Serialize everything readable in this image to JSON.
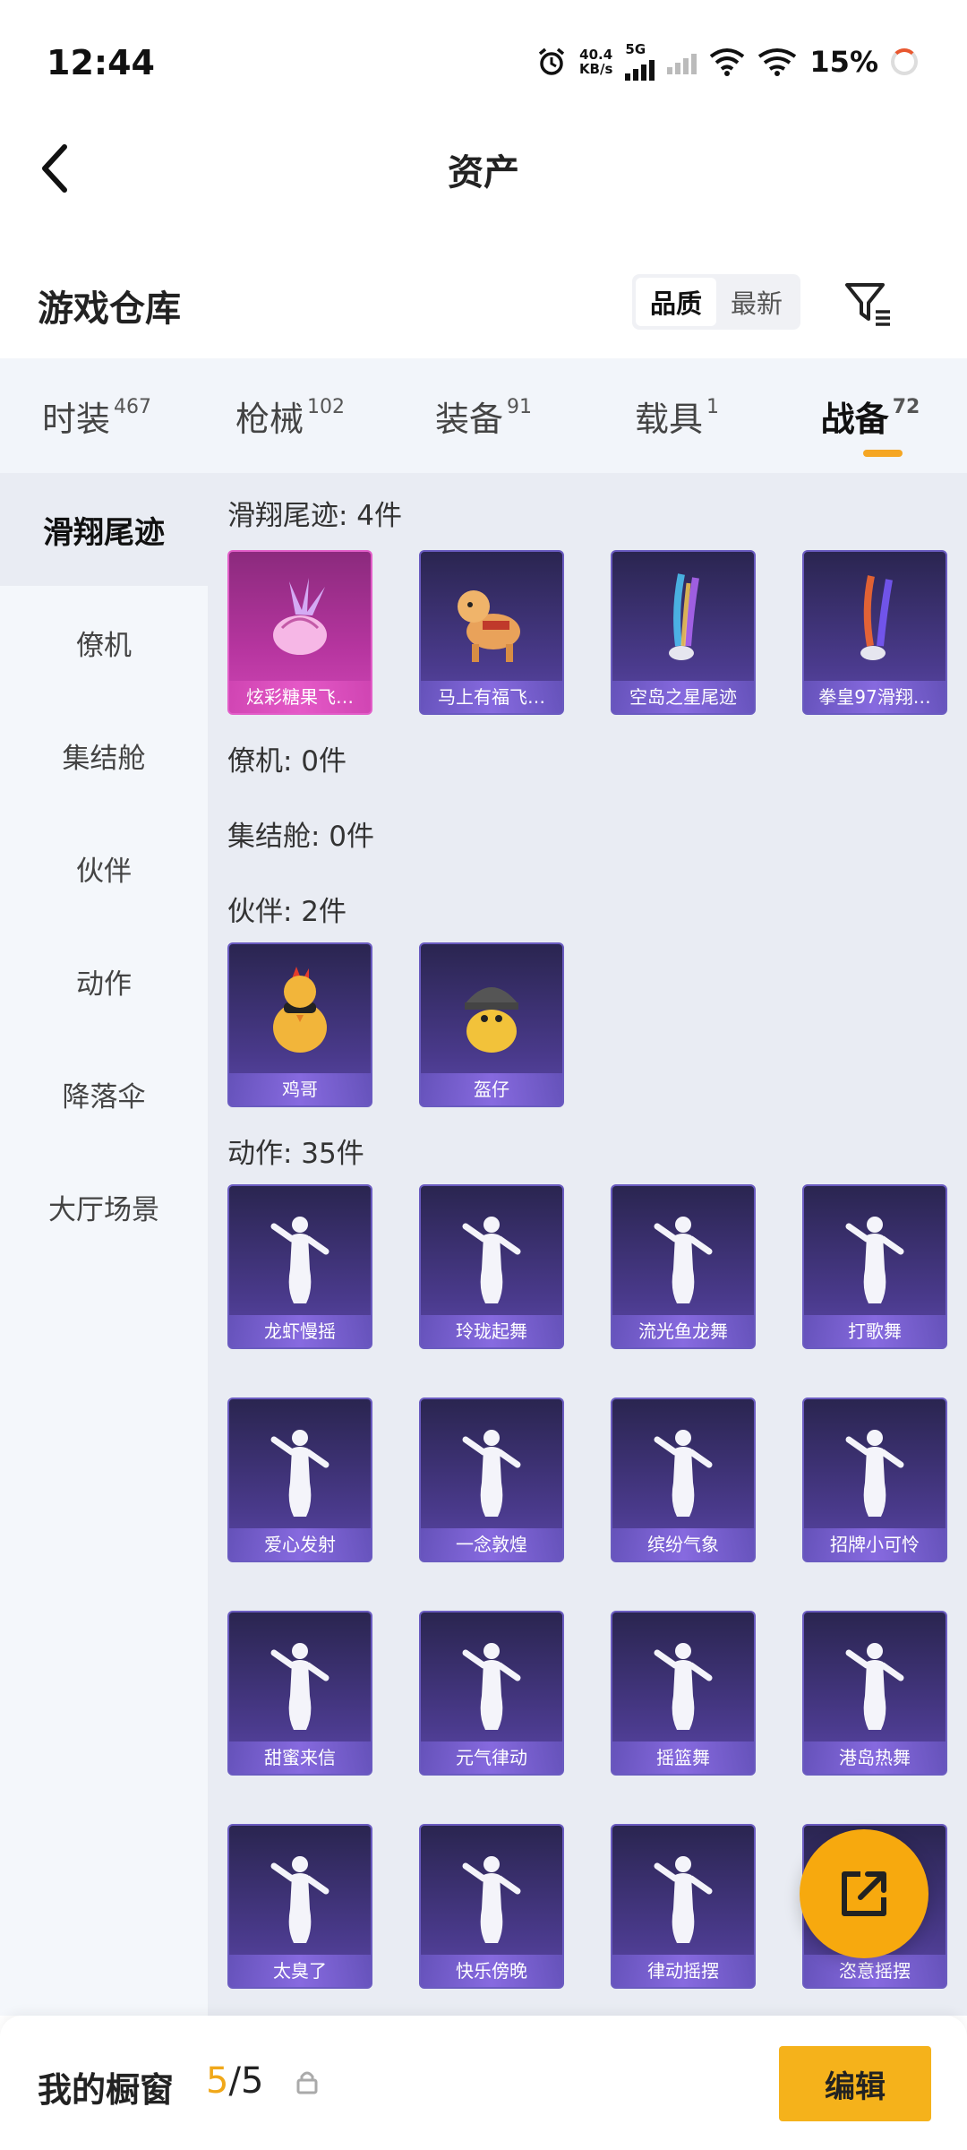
{
  "status_bar": {
    "time": "12:44",
    "net_speed_value": "40.4",
    "net_speed_unit": "KB/s",
    "network_type": "5G",
    "battery": "15%"
  },
  "header": {
    "title": "资产"
  },
  "warehouse": {
    "title": "游戏仓库",
    "sort_options": [
      "品质",
      "最新"
    ]
  },
  "tabs": [
    {
      "label": "时装",
      "count": "467"
    },
    {
      "label": "枪械",
      "count": "102"
    },
    {
      "label": "装备",
      "count": "91"
    },
    {
      "label": "载具",
      "count": "1"
    },
    {
      "label": "战备",
      "count": "72"
    }
  ],
  "sidebar": [
    "滑翔尾迹",
    "僚机",
    "集结舱",
    "伙伴",
    "动作",
    "降落伞",
    "大厅场景"
  ],
  "sections": {
    "glide": "滑翔尾迹: 4件",
    "wingman": "僚机: 0件",
    "assembly": "集结舱: 0件",
    "partner": "伙伴: 2件",
    "emote": "动作: 35件"
  },
  "items": {
    "glide": [
      "炫彩糖果飞…",
      "马上有福飞…",
      "空岛之星尾迹",
      "拳皇97滑翔…"
    ],
    "partner": [
      "鸡哥",
      "盔仔"
    ],
    "emote": [
      "龙虾慢摇",
      "玲珑起舞",
      "流光鱼龙舞",
      "打歌舞",
      "爱心发射",
      "一念敦煌",
      "缤纷气象",
      "招牌小可怜",
      "甜蜜来信",
      "元气律动",
      "摇篮舞",
      "港岛热舞",
      "太臭了",
      "快乐傍晚",
      "律动摇摆",
      "恣意摇摆"
    ]
  },
  "bottom_bar": {
    "label": "我的橱窗",
    "current": "5",
    "separator": "/",
    "total": "5",
    "edit_label": "编辑"
  },
  "colors": {
    "accent": "#f5b21b",
    "tab_indicator": "#f5a623",
    "card_purple": "#4a3a8c",
    "card_pink": "#b6359f"
  }
}
